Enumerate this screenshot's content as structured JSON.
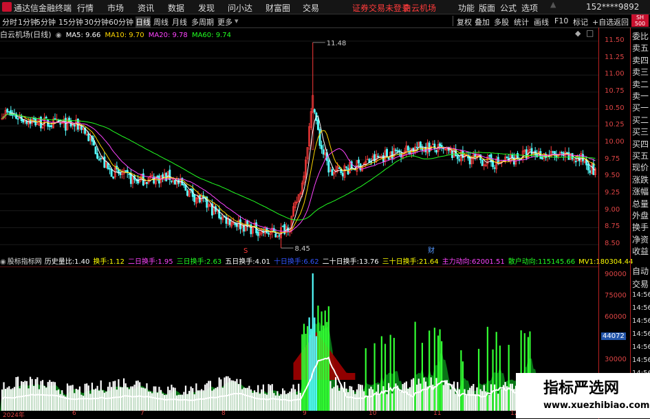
{
  "app": {
    "title": "通达信金融终端",
    "menus": [
      "行情",
      "市场",
      "资讯",
      "数据",
      "发现",
      "问小达",
      "财富圈",
      "交易"
    ],
    "status": "证券交易未登录",
    "stock": "白云机场",
    "right_menus": [
      "功能",
      "版面",
      "公式",
      "选项"
    ],
    "account": "152****9892",
    "badge_sh": "SH",
    "badge_num": "500"
  },
  "timebar": {
    "periods": [
      "分时",
      "1分钟",
      "5分钟",
      "15分钟",
      "30分钟",
      "60分钟",
      "日线",
      "周线",
      "月线",
      "多周期",
      "更多"
    ],
    "selected": "日线",
    "tools": [
      "复权",
      "叠加",
      "多股",
      "统计",
      "画线",
      "F10",
      "标记",
      "返回"
    ],
    "add_watch": "+自选"
  },
  "main": {
    "name": "白云机场(日线)",
    "ma": [
      {
        "label": "MA5: 9.66",
        "color": "#ffffff"
      },
      {
        "label": "MA10: 9.70",
        "color": "#ffd700"
      },
      {
        "label": "MA20: 9.78",
        "color": "#ff44ff"
      },
      {
        "label": "MA60: 9.74",
        "color": "#22ff22"
      }
    ],
    "high_label": "11.48",
    "low_label": "8.45",
    "marker_s": "S",
    "marker_cai": "财"
  },
  "chart_data": {
    "type": "candlestick",
    "price_ticks": [
      "11.50",
      "11.25",
      "11.00",
      "10.75",
      "10.50",
      "10.25",
      "10.00",
      "9.75",
      "9.50",
      "9.25",
      "9.00",
      "8.75",
      "8.50"
    ],
    "ylim": [
      8.4,
      11.6
    ],
    "high": 11.48,
    "low": 8.45,
    "vol_ticks": [
      "90000",
      "75000",
      "60000",
      "45000",
      "30000"
    ],
    "vol_current": "44072",
    "x_labels": [
      "2024年",
      "6",
      "7",
      "8",
      "9",
      "10",
      "11",
      "12"
    ],
    "ma_values": {
      "MA5": 9.66,
      "MA10": 9.7,
      "MA20": 9.78,
      "MA60": 9.74
    }
  },
  "indicator": {
    "name": "股标指标网",
    "items": [
      {
        "label": "历史量比:",
        "value": "1.40",
        "color": "#ffffff"
      },
      {
        "label": "换手:",
        "value": "1.12",
        "color": "#ffff00"
      },
      {
        "label": "二日换手:",
        "value": "1.95",
        "color": "#ff44ff"
      },
      {
        "label": "三日换手:",
        "value": "2.63",
        "color": "#22ff22"
      },
      {
        "label": "五日换手:",
        "value": "4.01",
        "color": "#ffffff"
      },
      {
        "label": "十日换手:",
        "value": "6.62",
        "color": "#3355ff"
      },
      {
        "label": "二十日换手:",
        "value": "13.76",
        "color": "#ffffff"
      },
      {
        "label": "三十日换手:",
        "value": "21.64",
        "color": "#ffff00"
      },
      {
        "label": "主力动向:",
        "value": "62001.51",
        "color": "#ff44ff"
      },
      {
        "label": "散户动向:",
        "value": "115145.66",
        "color": "#22ff22"
      },
      {
        "label": "MV1:",
        "value": "180304.44",
        "color": "#ffff00"
      }
    ]
  },
  "right_panel": [
    "委比",
    "卖五",
    "卖四",
    "卖三",
    "卖二",
    "卖一",
    "买一",
    "买二",
    "买三",
    "买四",
    "买五",
    "现价",
    "涨跌",
    "涨幅",
    "总量",
    "外盘",
    "换手",
    "净资",
    "收益"
  ],
  "right_panel_lower": [
    "自动",
    "交易",
    "14:56",
    "14:56",
    "14:56",
    "14:56",
    "14:56",
    "14:56",
    "14:56",
    "14:56"
  ],
  "watermark": {
    "title": "指标严选网",
    "url": "www.xuezhibiao.com"
  }
}
